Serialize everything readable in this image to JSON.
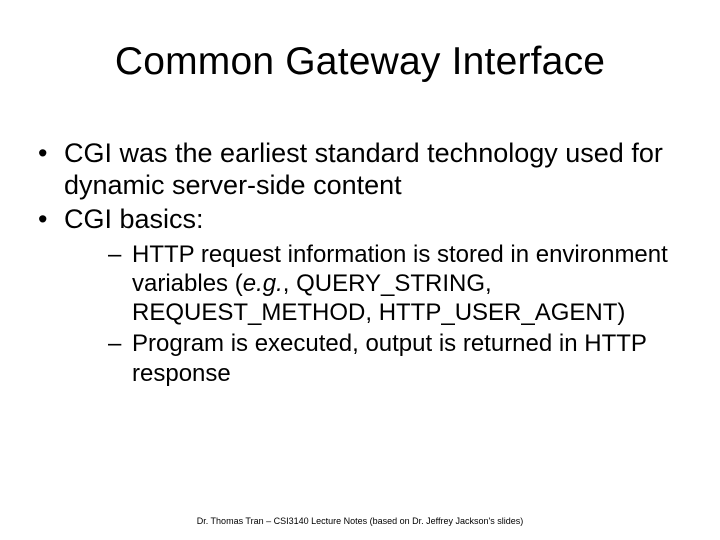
{
  "title": "Common Gateway Interface",
  "bullets": [
    "CGI was the earliest standard technology used for dynamic server-side content",
    "CGI basics:"
  ],
  "sub_bullets": [
    {
      "pre": "HTTP request information is stored in environment variables (",
      "eg": "e.g.",
      "post": ", QUERY_STRING, REQUEST_METHOD, HTTP_USER_AGENT)"
    },
    {
      "text": "Program is executed, output is returned in HTTP response"
    }
  ],
  "footer": "Dr. Thomas Tran – CSI3140 Lecture Notes (based on Dr. Jeffrey Jackson's slides)"
}
